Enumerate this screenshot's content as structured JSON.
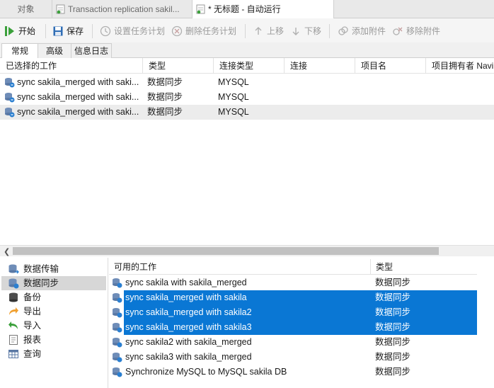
{
  "tabs": [
    {
      "label": "对象"
    },
    {
      "label": "Transaction replication sakil..."
    },
    {
      "label": "* 无标题 - 自动运行"
    }
  ],
  "toolbar": {
    "start": "开始",
    "save": "保存",
    "set_schedule": "设置任务计划",
    "delete_schedule": "删除任务计划",
    "move_up": "上移",
    "move_down": "下移",
    "add_attachment": "添加附件",
    "remove_attachment": "移除附件"
  },
  "subtabs": [
    "常规",
    "高级",
    "信息日志"
  ],
  "selected_jobs": {
    "headers": [
      "已选择的工作",
      "类型",
      "连接类型",
      "连接",
      "项目名",
      "项目拥有者 Navi"
    ],
    "rows": [
      {
        "name": "sync sakila_merged with saki...",
        "type": "数据同步",
        "conn_type": "MYSQL"
      },
      {
        "name": "sync sakila_merged with saki...",
        "type": "数据同步",
        "conn_type": "MYSQL"
      },
      {
        "name": "sync sakila_merged with saki...",
        "type": "数据同步",
        "conn_type": "MYSQL"
      }
    ]
  },
  "categories": [
    {
      "label": "数据传输",
      "icon": "data-transfer-icon"
    },
    {
      "label": "数据同步",
      "icon": "data-sync-icon"
    },
    {
      "label": "备份",
      "icon": "backup-icon"
    },
    {
      "label": "导出",
      "icon": "export-icon"
    },
    {
      "label": "导入",
      "icon": "import-icon"
    },
    {
      "label": "报表",
      "icon": "report-icon"
    },
    {
      "label": "查询",
      "icon": "query-icon"
    }
  ],
  "available_jobs": {
    "headers": [
      "可用的工作",
      "类型"
    ],
    "rows": [
      {
        "name": "sync sakila with sakila_merged",
        "type": "数据同步"
      },
      {
        "name": "sync sakila_merged with sakila",
        "type": "数据同步"
      },
      {
        "name": "sync sakila_merged with sakila2",
        "type": "数据同步"
      },
      {
        "name": "sync sakila_merged with sakila3",
        "type": "数据同步"
      },
      {
        "name": "sync sakila2 with sakila_merged",
        "type": "数据同步"
      },
      {
        "name": "sync sakila3 with sakila_merged",
        "type": "数据同步"
      },
      {
        "name": "Synchronize MySQL to MySQL sakila DB",
        "type": "数据同步"
      }
    ]
  },
  "colors": {
    "selection": "#0a77d4",
    "start_green": "#3aa03a",
    "save_blue": "#2f6db5"
  }
}
